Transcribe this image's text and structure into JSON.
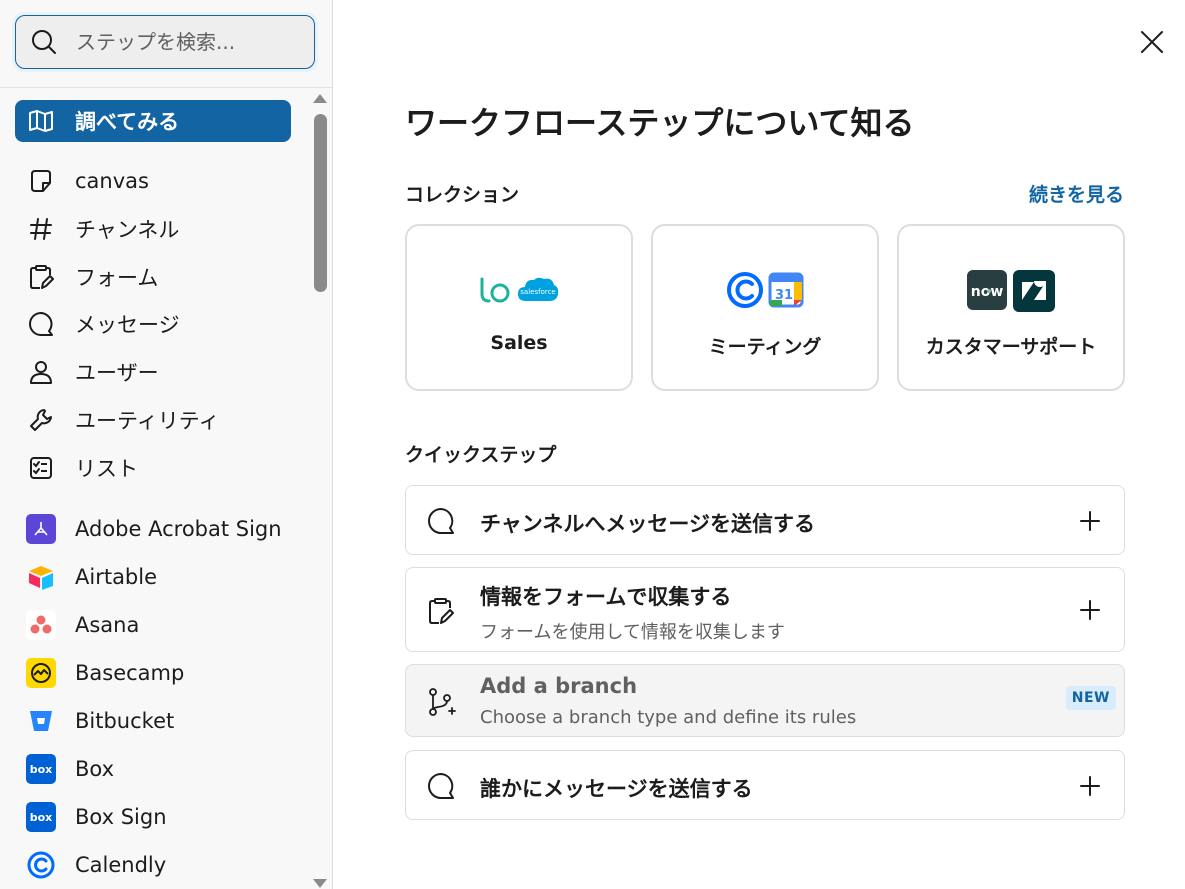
{
  "search": {
    "placeholder": "ステップを検索..."
  },
  "sidebar": {
    "items": [
      {
        "label": "調べてみる",
        "icon": "book-open-icon",
        "active": true
      },
      {
        "label": "canvas",
        "icon": "canvas-icon"
      },
      {
        "label": "チャンネル",
        "icon": "hash-icon"
      },
      {
        "label": "フォーム",
        "icon": "form-icon"
      },
      {
        "label": "メッセージ",
        "icon": "message-icon"
      },
      {
        "label": "ユーザー",
        "icon": "user-icon"
      },
      {
        "label": "ユーティリティ",
        "icon": "wrench-icon"
      },
      {
        "label": "リスト",
        "icon": "list-icon"
      },
      {
        "label": "Adobe Acrobat Sign",
        "icon": "adobe-acrobat-sign-icon"
      },
      {
        "label": "Airtable",
        "icon": "airtable-icon"
      },
      {
        "label": "Asana",
        "icon": "asana-icon"
      },
      {
        "label": "Basecamp",
        "icon": "basecamp-icon"
      },
      {
        "label": "Bitbucket",
        "icon": "bitbucket-icon"
      },
      {
        "label": "Box",
        "icon": "box-icon"
      },
      {
        "label": "Box Sign",
        "icon": "box-sign-icon"
      },
      {
        "label": "Calendly",
        "icon": "calendly-icon"
      }
    ]
  },
  "main": {
    "title": "ワークフローステップについて知る",
    "collections": {
      "label": "コレクション",
      "see_more": "続きを見る",
      "cards": [
        {
          "name": "Sales",
          "logos": [
            "lo",
            "salesforce"
          ]
        },
        {
          "name": "ミーティング",
          "logos": [
            "calendly",
            "31"
          ]
        },
        {
          "name": "カスタマーサポート",
          "logos": [
            "now",
            "Z"
          ]
        }
      ]
    },
    "quick_steps": {
      "label": "クイックステップ",
      "steps": [
        {
          "title": "チャンネルへメッセージを送信する",
          "icon": "message-icon"
        },
        {
          "title": "情報をフォームで収集する",
          "desc": "フォームを使用して情報を収集します",
          "icon": "form-icon"
        },
        {
          "title": "Add a branch",
          "desc": "Choose a branch type and define its rules",
          "badge": "NEW",
          "icon": "branch-icon"
        },
        {
          "title": "誰かにメッセージを送信する",
          "icon": "message-icon"
        }
      ]
    }
  },
  "colors": {
    "accent": "#1264a3",
    "sidebar_bg": "#f8f8f8",
    "badge_bg": "#d8ecfb"
  }
}
